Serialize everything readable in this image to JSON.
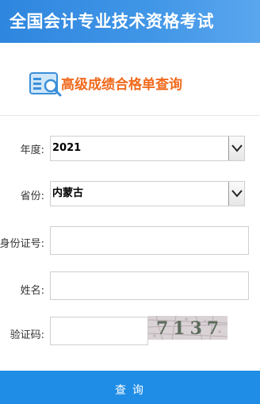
{
  "header": {
    "title": "全国会计专业技术资格考试"
  },
  "subheader": {
    "title": "高级成绩合格单查询",
    "icon": "id-card-search-icon"
  },
  "form": {
    "year": {
      "label": "年度:",
      "value": "2021"
    },
    "province": {
      "label": "省份:",
      "value": "内蒙古"
    },
    "id_number": {
      "label": "身份证号:",
      "value": ""
    },
    "name": {
      "label": "姓名:",
      "value": ""
    },
    "captcha": {
      "label": "验证码:",
      "value": "",
      "code": "7137"
    }
  },
  "submit": {
    "label": "查 询"
  },
  "colors": {
    "header": "#2f86de",
    "accent": "#f06a1d",
    "button": "#1f8de6"
  }
}
